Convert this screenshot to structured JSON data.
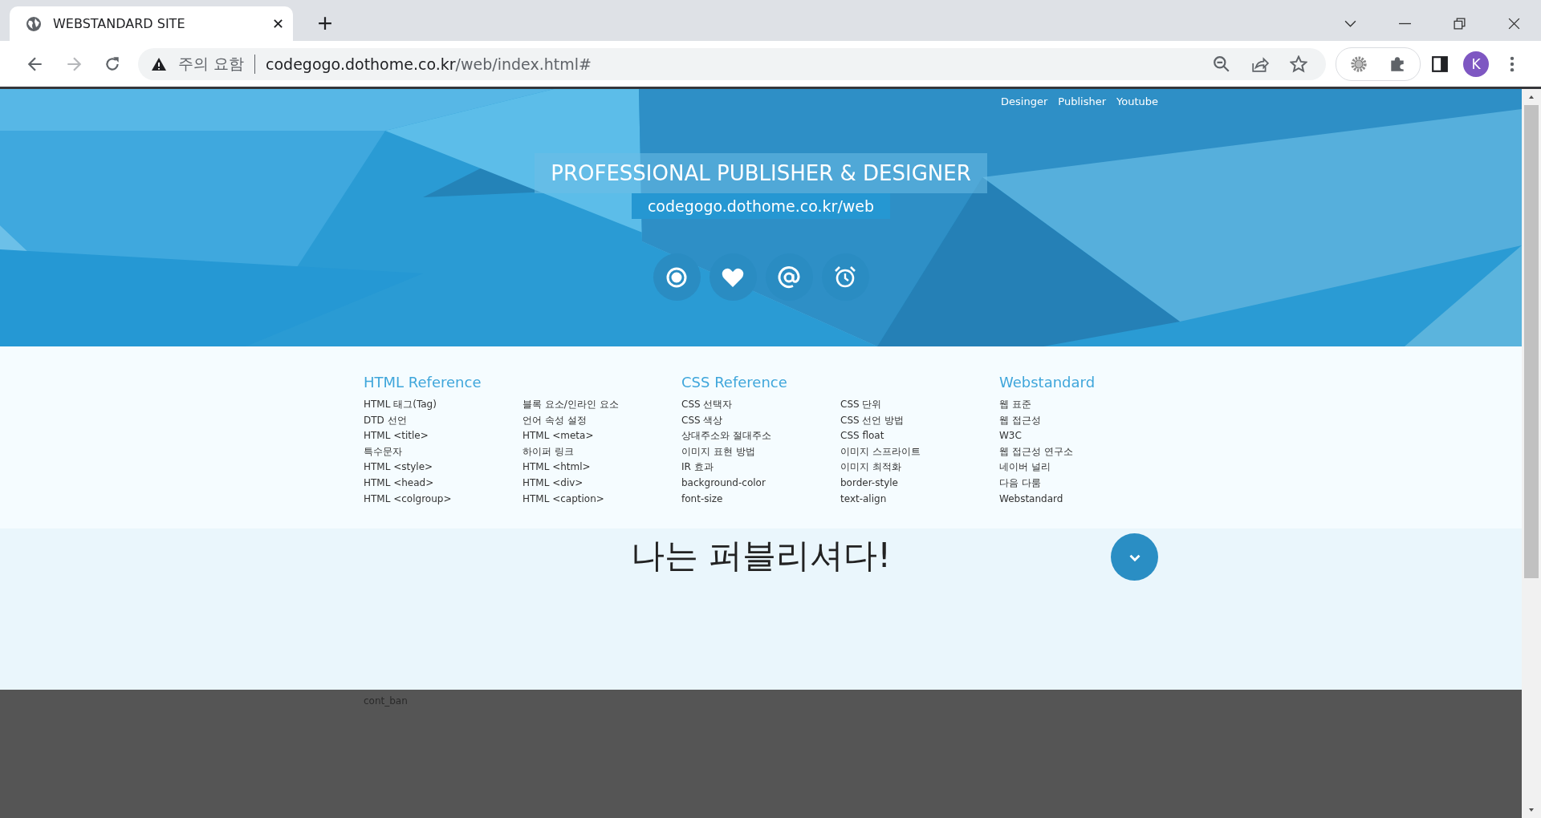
{
  "browser": {
    "tab_title": "WEBSTANDARD SITE",
    "security_label": "주의 요함",
    "url_host": "codegogo.dothome.co.kr",
    "url_path": "/web/index.html#",
    "profile_initial": "K"
  },
  "header": {
    "nav": [
      "Desinger",
      "Publisher",
      "Youtube"
    ],
    "title": "PROFESSIONAL PUBLISHER & DESIGNER",
    "subtitle": "codegogo.dothome.co.kr/web",
    "icons": [
      {
        "kind": "target"
      },
      {
        "kind": "heart"
      },
      {
        "kind": "at"
      },
      {
        "kind": "alarm"
      }
    ]
  },
  "references": [
    {
      "heading": "HTML Reference",
      "columns": [
        {
          "links": [
            "HTML 태그(Tag)",
            "DTD 선언",
            "HTML <title>",
            "특수문자",
            "HTML <style>",
            "HTML <head>",
            "HTML <colgroup>"
          ]
        },
        {
          "links": [
            "블록 요소/인라인 요소",
            "언어 속성 설정",
            "HTML <meta>",
            "하이퍼 링크",
            "HTML <html>",
            "HTML <div>",
            "HTML <caption>"
          ]
        }
      ]
    },
    {
      "heading": "CSS Reference",
      "columns": [
        {
          "links": [
            "CSS 선택자",
            "CSS 색상",
            "상대주소와 절대주소",
            "이미지 표현 방법",
            "IR 효과",
            "background-color",
            "font-size"
          ]
        },
        {
          "links": [
            "CSS 단위",
            "CSS 선언 방법",
            "CSS float",
            "이미지 스프라이트",
            "이미지 최적화",
            "border-style",
            "text-align"
          ]
        }
      ]
    },
    {
      "heading": "Webstandard",
      "columns": [
        {
          "links": [
            "웹 표준",
            "웹 접근성",
            "W3C",
            "웹 접근성 연구소",
            "네이버 널리",
            "다음 다룸",
            "Webstandard"
          ]
        }
      ]
    }
  ],
  "banner": {
    "heading": "나는 퍼블리셔다!"
  },
  "footer": {
    "label": "cont_ban"
  }
}
